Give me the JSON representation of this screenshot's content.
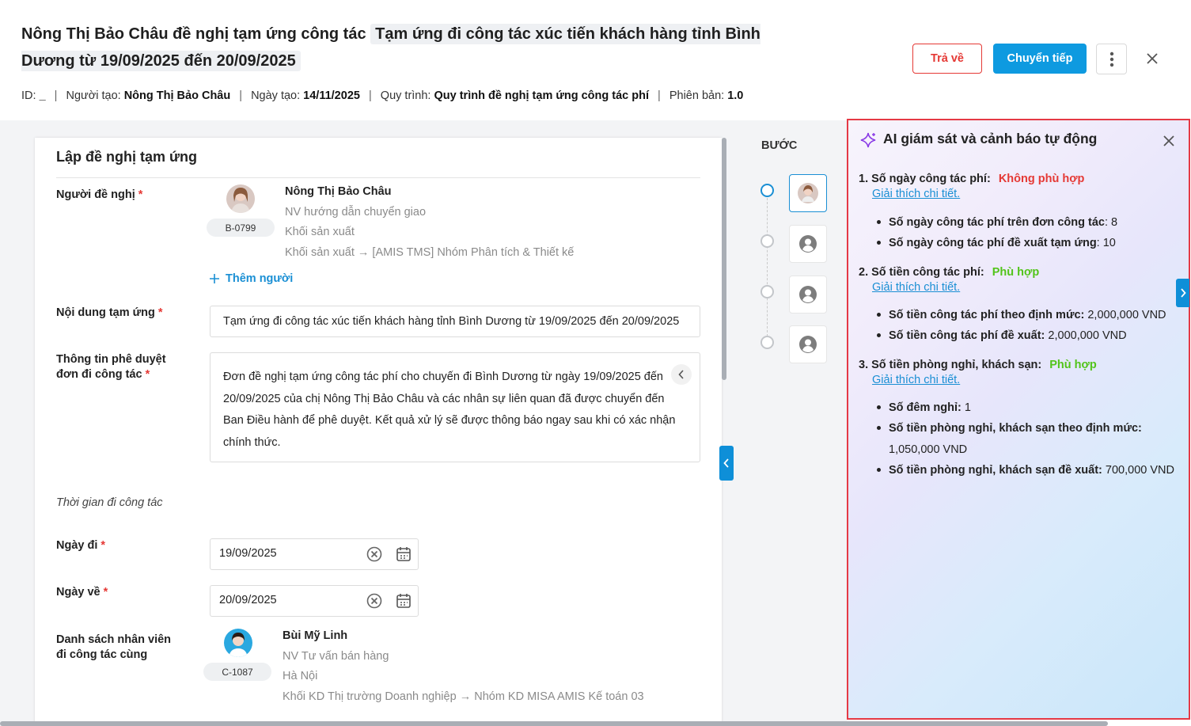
{
  "header": {
    "title_prefix": "Nông Thị Bảo Châu đề nghị tạm ứng công tác",
    "title_highlight": "Tạm ứng đi công tác xúc tiến khách hàng tỉnh Bình Dương từ 19/09/2025 đến 20/09/2025",
    "meta": {
      "id_label": "ID:",
      "id_value": "_",
      "creator_label": "Người tạo:",
      "creator_value": "Nông Thị Bảo Châu",
      "created_date_label": "Ngày tạo:",
      "created_date_value": "14/11/2025",
      "process_label": "Quy trình:",
      "process_value": "Quy trình đề nghị tạm ứng công tác phí",
      "version_label": "Phiên bản:",
      "version_value": "1.0"
    },
    "buttons": {
      "return_label": "Trả về",
      "forward_label": "Chuyển tiếp"
    }
  },
  "form": {
    "section_title": "Lập đề nghị tạm ứng",
    "requester": {
      "label": "Người đề nghị",
      "code": "B-0799",
      "name": "Nông Thị Bảo Châu",
      "position": "NV hướng dẫn chuyển giao",
      "unit": "Khối sản xuất",
      "path": "Khối sản xuất → [AMIS TMS] Nhóm Phân tích & Thiết kế"
    },
    "add_person_label": "Thêm người",
    "advance_content": {
      "label": "Nội dung tạm ứng",
      "value": "Tạm ứng đi công tác xúc tiến khách hàng tỉnh Bình Dương từ 19/09/2025 đến 20/09/2025"
    },
    "approval_info": {
      "label_line1": "Thông tin phê duyệt",
      "label_line2": "đơn đi công tác",
      "value": "Đơn đề nghị tạm ứng công tác phí cho chuyến đi Bình Dương từ ngày 19/09/2025 đến 20/09/2025 của chị Nông Thị Bảo Châu và các nhân sự liên quan đã được chuyển đến Ban Điều hành để phê duyệt. Kết quả xử lý sẽ được thông báo ngay sau khi có xác nhận chính thức."
    },
    "trip_time_label": "Thời gian đi công tác",
    "departure": {
      "label": "Ngày đi",
      "value": "19/09/2025"
    },
    "return_date": {
      "label": "Ngày về",
      "value": "20/09/2025"
    },
    "companions": {
      "label_line1": "Danh sách nhân viên",
      "label_line2": "đi công tác cùng",
      "code": "C-1087",
      "name": "Bùi Mỹ Linh",
      "position": "NV Tư vấn bán hàng",
      "location": "Hà Nội",
      "path": "Khối KD Thị trường Doanh nghiệp → Nhóm KD MISA AMIS Kế toán 03"
    }
  },
  "steps": {
    "label": "BƯỚC"
  },
  "ai_panel": {
    "title": "AI giám sát và cảnh báo tự động",
    "link_label": "Giải thích chi tiết.",
    "items": [
      {
        "head": "1. Số ngày công tác phí:",
        "status": "Không phù hợp",
        "bullets": [
          {
            "label": "Số ngày công tác phí trên đơn công tác",
            "value": ": 8"
          },
          {
            "label": "Số ngày công tác phí đề xuất tạm ứng",
            "value": ": 10"
          }
        ]
      },
      {
        "head": "2. Số tiền công tác phí:",
        "status": "Phù hợp",
        "bullets": [
          {
            "label": "Số tiền công tác phí theo định mức:",
            "value": " 2,000,000 VND"
          },
          {
            "label": "Số tiền công tác phí đề xuất:",
            "value": " 2,000,000 VND"
          }
        ]
      },
      {
        "head": "3. Số tiền phòng nghỉ, khách sạn:",
        "status": "Phù hợp",
        "bullets": [
          {
            "label": "Số đêm nghỉ:",
            "value": " 1"
          },
          {
            "label": "Số tiền phòng nghỉ, khách sạn theo định mức:",
            "value": ""
          },
          {
            "label": "",
            "value": "1,050,000 VND"
          },
          {
            "label": "Số tiền phòng nghỉ, khách sạn đề xuất:",
            "value": " 700,000 VND"
          }
        ]
      }
    ],
    "colors": {
      "bad": "#e53935",
      "good": "#52c41a",
      "border": "#e53945"
    }
  }
}
